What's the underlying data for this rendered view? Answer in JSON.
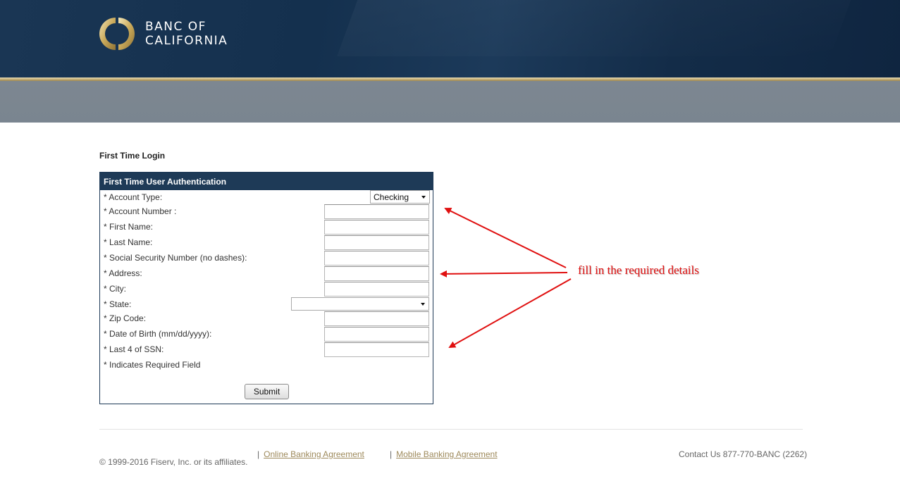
{
  "brand": {
    "name_line1": "BANC OF",
    "name_line2": "CALIFORNIA"
  },
  "page": {
    "title": "First Time Login"
  },
  "form": {
    "header": "First Time User Authentication",
    "fields": [
      {
        "label": "* Account Type:",
        "type": "select",
        "value": "Checking"
      },
      {
        "label": "* Account Number :",
        "type": "text",
        "value": ""
      },
      {
        "label": "* First Name:",
        "type": "text",
        "value": ""
      },
      {
        "label": "* Last Name:",
        "type": "text",
        "value": ""
      },
      {
        "label": "* Social Security Number (no dashes):",
        "type": "text",
        "value": ""
      },
      {
        "label": "* Address:",
        "type": "text",
        "value": ""
      },
      {
        "label": "* City:",
        "type": "text",
        "value": ""
      },
      {
        "label": "* State:",
        "type": "select",
        "value": ""
      },
      {
        "label": "* Zip Code:",
        "type": "text",
        "value": ""
      },
      {
        "label": "* Date of Birth (mm/dd/yyyy):",
        "type": "text",
        "value": ""
      },
      {
        "label": "* Last 4 of SSN:",
        "type": "text",
        "value": ""
      }
    ],
    "required_note": "* Indicates Required Field",
    "submit_label": "Submit"
  },
  "annotation": {
    "text": "fill in the required details",
    "color": "#e01010"
  },
  "footer": {
    "copyright": "© 1999-2016 Fiserv, Inc. or its affiliates.",
    "separator": "|",
    "links": [
      "Online Banking Agreement",
      "Mobile Banking Agreement"
    ],
    "contact": "Contact Us 877-770-BANC (2262)"
  },
  "colors": {
    "header_navy": "#14304e",
    "gold_accent": "#c8b27a",
    "gray_band": "#7d8791",
    "panel_header": "#1e3a57",
    "link_gold": "#9e8a5c"
  }
}
